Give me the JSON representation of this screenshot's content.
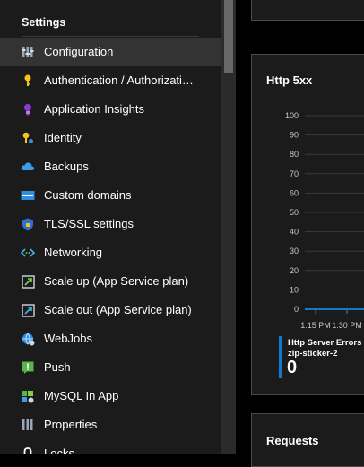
{
  "sidebar": {
    "section_title": "Settings",
    "items": [
      {
        "label": "Configuration",
        "icon": "configuration-icon",
        "active": true
      },
      {
        "label": "Authentication / Authorizati…",
        "icon": "key-icon"
      },
      {
        "label": "Application Insights",
        "icon": "lightbulb-icon"
      },
      {
        "label": "Identity",
        "icon": "identity-key-icon"
      },
      {
        "label": "Backups",
        "icon": "cloud-backup-icon"
      },
      {
        "label": "Custom domains",
        "icon": "www-icon"
      },
      {
        "label": "TLS/SSL settings",
        "icon": "shield-icon"
      },
      {
        "label": "Networking",
        "icon": "networking-arrows-icon"
      },
      {
        "label": "Scale up (App Service plan)",
        "icon": "scale-up-icon"
      },
      {
        "label": "Scale out (App Service plan)",
        "icon": "scale-out-icon"
      },
      {
        "label": "WebJobs",
        "icon": "webjobs-globe-icon"
      },
      {
        "label": "Push",
        "icon": "push-icon"
      },
      {
        "label": "MySQL In App",
        "icon": "mysql-icon"
      },
      {
        "label": "Properties",
        "icon": "properties-icon"
      },
      {
        "label": "Locks",
        "icon": "lock-icon"
      }
    ]
  },
  "main": {
    "http_card_title": "Http 5xx",
    "requests_card_title": "Requests",
    "legend": {
      "name": "Http Server Errors (Se",
      "resource": "zip-sticker-2",
      "value": "0",
      "color": "#0f7acf"
    }
  },
  "chart_data": {
    "type": "line",
    "title": "Http 5xx",
    "ylim": [
      0,
      100
    ],
    "y_ticks": [
      "0",
      "10",
      "20",
      "30",
      "40",
      "50",
      "60",
      "70",
      "80",
      "90",
      "100"
    ],
    "x_ticks": [
      "1:15 PM",
      "1:30 PM"
    ],
    "grid": true,
    "series": [
      {
        "name": "Http Server Errors (Se",
        "values": [
          0,
          0
        ]
      }
    ]
  },
  "colors": {
    "accent": "#0f7acf",
    "sidebar_bg": "#1b1b1b",
    "active_bg": "#333333"
  }
}
